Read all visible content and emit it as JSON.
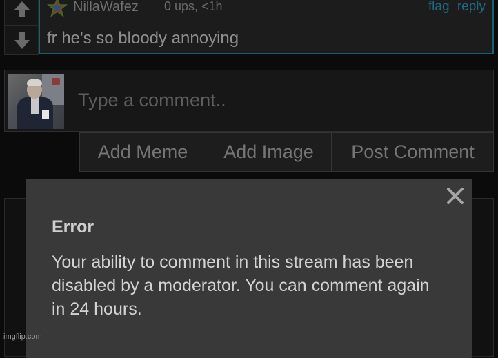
{
  "comment": {
    "username": "NillaWafez",
    "meta": "0 ups, <1h",
    "flag_label": "flag",
    "reply_label": "reply",
    "text": "fr he's so bloody annoying"
  },
  "composer": {
    "placeholder": "Type a comment.."
  },
  "buttons": {
    "add_meme": "Add Meme",
    "add_image": "Add Image",
    "post_comment": "Post Comment"
  },
  "dialog": {
    "title": "Error",
    "message": "Your ability to comment in this stream has been disabled by a moderator. You can comment again in 24 hours."
  },
  "watermark": "imgflip.com",
  "colors": {
    "accent_border": "#1a5f70",
    "link": "#1f6a88",
    "dialog_bg": "#393939"
  }
}
